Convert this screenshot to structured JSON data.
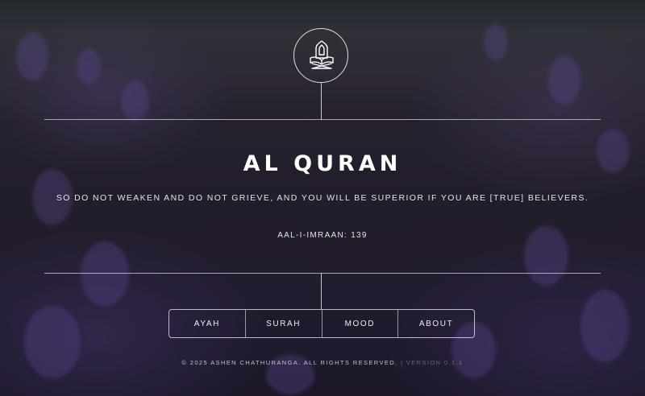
{
  "header": {
    "logo_icon": "quran-stand-icon"
  },
  "main": {
    "title": "AL QURAN",
    "verse": "SO DO NOT WEAKEN AND DO NOT GRIEVE, AND YOU WILL BE SUPERIOR IF YOU ARE [TRUE] BELIEVERS.",
    "reference": "AAL-I-IMRAAN: 139"
  },
  "nav": {
    "items": [
      {
        "label": "AYAH"
      },
      {
        "label": "SURAH"
      },
      {
        "label": "MOOD"
      },
      {
        "label": "ABOUT"
      }
    ]
  },
  "footer": {
    "copyright": "© 2025 ASHEN CHATHURANGA. ALL RIGHTS RESERVED.",
    "version": "| VERSION 0.1.1"
  }
}
